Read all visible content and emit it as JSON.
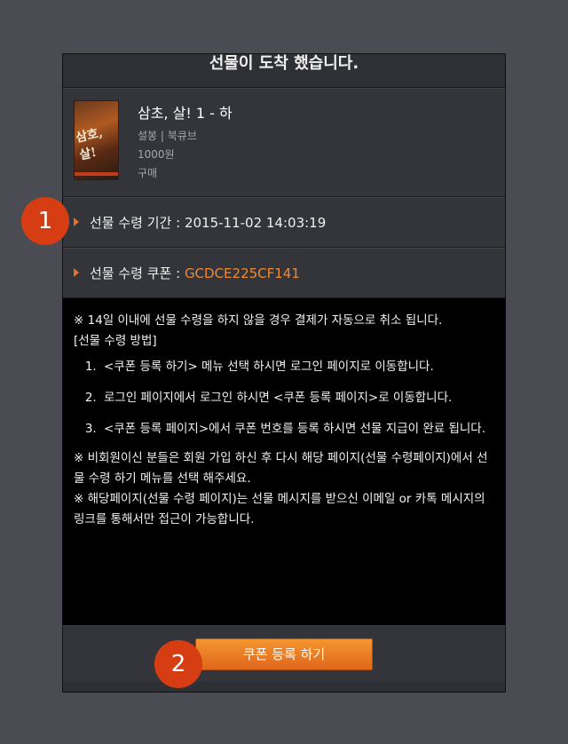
{
  "header": {
    "title": "선물이 도착 했습니다."
  },
  "product": {
    "cover_text": "삼호,살!",
    "title": "삼초, 살! 1 - 하",
    "author_publisher": "설봉 | 북큐브",
    "price": "1000원",
    "type": "구매"
  },
  "receive_period": {
    "label": "선물 수령 기간 : ",
    "value": "2015-11-02 14:03:19"
  },
  "receive_coupon": {
    "label": "선물 수령 쿠폰 : ",
    "code": "GCDCE225CF141"
  },
  "notice": {
    "warning": "※ 14일 이내에 선물 수령을 하지 않을 경우 결제가 자동으로 취소 됩니다.",
    "method_title": "[선물 수령 방법]",
    "steps": [
      "<쿠폰 등록 하기> 메뉴 선택 하시면 로그인 페이지로 이동합니다.",
      "로그인 페이지에서 로그인 하시면 <쿠폰 등록 페이지>로 이동합니다.",
      "<쿠폰 등록 페이지>에서 쿠폰 번호를 등록 하시면 선물 지급이 완료 됩니다."
    ],
    "nonmember": "※ 비회원이신 분들은 회원 가입 하신 후 다시 해당 페이지(선물 수령페이지)에서 선물 수령 하기 메뉴를 선택 해주세요.",
    "access": "※ 해당페이지(선물 수령 페이지)는 선물 메시지를 받으신 이메일 or 카톡 메시지의 링크를 통해서만 접근이 가능합니다."
  },
  "footer": {
    "coupon_button": "쿠폰 등록 하기"
  },
  "annotations": {
    "badge1": "1",
    "badge2": "2"
  },
  "colors": {
    "accent": "#f08a2c",
    "badge": "#d73d12",
    "button": "#ee7d25"
  }
}
